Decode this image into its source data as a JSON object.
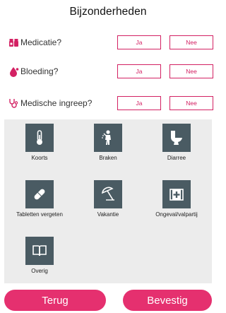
{
  "header": {
    "title": "Bijzonderheden"
  },
  "questions": [
    {
      "label": "Medicatie?",
      "icon": "pill-bottle-icon",
      "yes": "Ja",
      "no": "Nee"
    },
    {
      "label": "Bloeding?",
      "icon": "blood-drop-icon",
      "yes": "Ja",
      "no": "Nee"
    },
    {
      "label": "Medische ingreep?",
      "icon": "stethoscope-icon",
      "yes": "Ja",
      "no": "Nee"
    }
  ],
  "categories": [
    {
      "label": "Koorts",
      "icon": "thermometer-icon"
    },
    {
      "label": "Braken",
      "icon": "vomiting-person-icon"
    },
    {
      "label": "Diarree",
      "icon": "toilet-icon"
    },
    {
      "label": "Tabletten vergeten",
      "icon": "capsule-icon"
    },
    {
      "label": "Vakantie",
      "icon": "beach-umbrella-icon"
    },
    {
      "label": "Ongeval/valpartij",
      "icon": "first-aid-kit-icon"
    },
    {
      "label": "Overig",
      "icon": "open-book-icon"
    }
  ],
  "footer": {
    "back_label": "Terug",
    "confirm_label": "Bevestig"
  },
  "colors": {
    "accent": "#e5306f",
    "tile": "#4a5b63",
    "panel": "#ececec"
  }
}
